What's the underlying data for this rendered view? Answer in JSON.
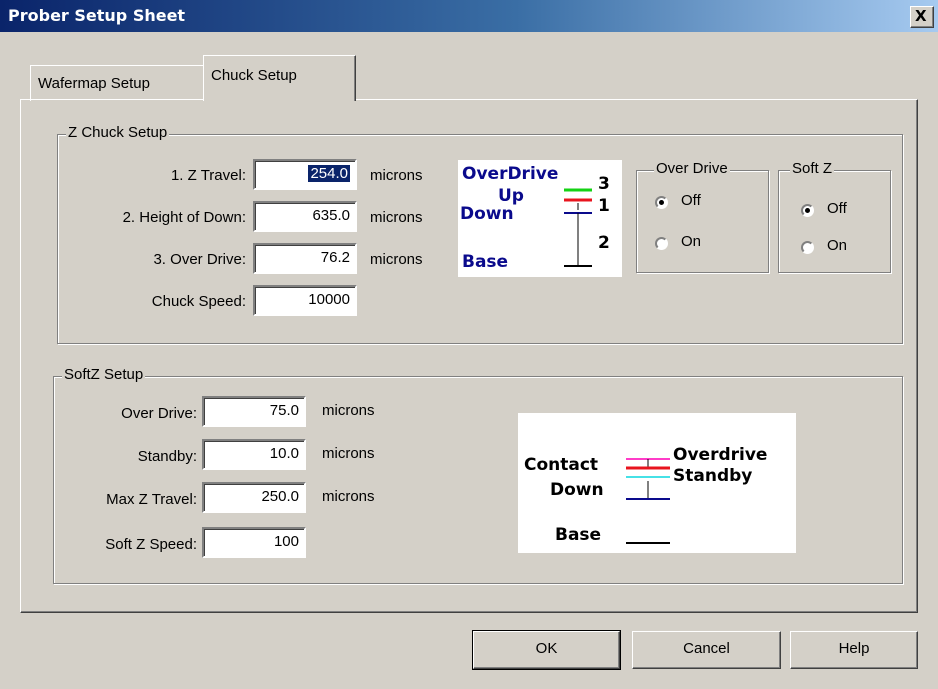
{
  "window": {
    "title": "Prober Setup Sheet",
    "close_glyph": "X"
  },
  "tabs": [
    {
      "label": "Wafermap Setup",
      "active": false
    },
    {
      "label": "Chuck Setup",
      "active": true
    }
  ],
  "z_chuck_setup": {
    "group_label": "Z Chuck Setup",
    "fields": [
      {
        "label": "1. Z Travel:",
        "value": "254.0",
        "unit": "microns"
      },
      {
        "label": "2. Height of Down:",
        "value": "635.0",
        "unit": "microns"
      },
      {
        "label": "3. Over Drive:",
        "value": "76.2",
        "unit": "microns"
      },
      {
        "label": "Chuck Speed:",
        "value": "10000"
      }
    ],
    "diagram": {
      "overdrive": "OverDrive",
      "up": "Up",
      "down": "Down",
      "base": "Base",
      "n3": "3",
      "n1": "1",
      "n2": "2"
    }
  },
  "over_drive_group": {
    "label": "Over Drive",
    "options": [
      {
        "label": "Off",
        "checked": true
      },
      {
        "label": "On",
        "checked": false
      }
    ]
  },
  "soft_z_group": {
    "label": "Soft Z",
    "options": [
      {
        "label": "Off",
        "checked": true
      },
      {
        "label": "On",
        "checked": false
      }
    ]
  },
  "softz_setup": {
    "group_label": "SoftZ Setup",
    "fields": [
      {
        "label": "Over Drive:",
        "value": "75.0",
        "unit": "microns"
      },
      {
        "label": "Standby:",
        "value": "10.0",
        "unit": "microns"
      },
      {
        "label": "Max Z Travel:",
        "value": "250.0",
        "unit": "microns"
      },
      {
        "label": "Soft Z Speed:",
        "value": "100"
      }
    ],
    "diagram": {
      "contact": "Contact",
      "down": "Down",
      "base": "Base",
      "overdrive": "Overdrive",
      "standby": "Standby"
    }
  },
  "buttons": {
    "ok": "OK",
    "cancel": "Cancel",
    "help": "Help"
  },
  "colors": {
    "title_gradient_start": "#0a246a",
    "dialog_face": "#d4d0c8",
    "diagram_text": "#0a0a8c",
    "line_red": "#e8141e",
    "line_green": "#14d214",
    "line_magenta": "#ff3cc8",
    "line_cyan": "#46e1e6",
    "line_navy": "#0a0a8c"
  }
}
